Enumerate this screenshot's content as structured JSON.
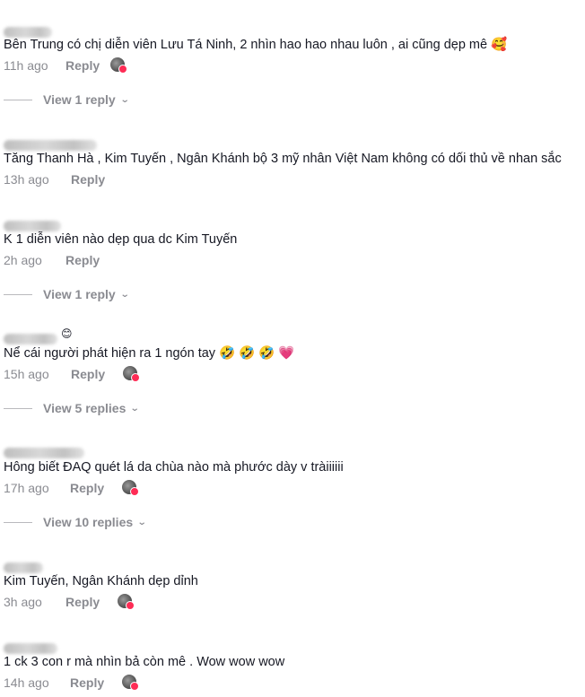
{
  "comments": [
    {
      "username": "",
      "text": "Bên Trung có chị diễn viên Lưu Tá Ninh, 2 nhìn hao hao nhau luôn , ai cũng dẹp mê 🥰",
      "time": "11h ago",
      "reply_label": "Reply",
      "creator_liked": true,
      "view_replies": "View 1 reply"
    },
    {
      "username": "",
      "text": "Tăng Thanh Hà , Kim Tuyến , Ngân Khánh bộ 3 mỹ nhân Việt Nam không có dối thủ về nhan sắc",
      "time": "13h ago",
      "reply_label": "Reply",
      "creator_liked": false,
      "view_replies": ""
    },
    {
      "username": "",
      "text": "K 1 diễn viên nào dẹp qua dc Kim Tuyến",
      "time": "2h ago",
      "reply_label": "Reply",
      "creator_liked": false,
      "view_replies": "View 1 reply"
    },
    {
      "username": "",
      "text": "Nể cái người phát hiện ra 1 ngón tay 🤣 🤣 🤣 💗",
      "time": "15h ago",
      "reply_label": "Reply",
      "creator_liked": true,
      "view_replies": "View 5 replies"
    },
    {
      "username": "",
      "text": "Hông biết ĐAQ quét lá da chùa nào mà phước dày v tràiiiiii",
      "time": "17h ago",
      "reply_label": "Reply",
      "creator_liked": true,
      "view_replies": "View 10 replies"
    },
    {
      "username": "",
      "text": "Kim Tuyến, Ngân Khánh dẹp dỉnh",
      "time": "3h ago",
      "reply_label": "Reply",
      "creator_liked": true,
      "view_replies": ""
    },
    {
      "username": "",
      "text": "1 ck 3 con r mà nhìn bả còn mê . Wow wow wow",
      "time": "14h ago",
      "reply_label": "Reply",
      "creator_liked": true,
      "view_replies": ""
    }
  ],
  "icons": {
    "creator_like": "creator-liked-avatar-icon",
    "chevron": "chevron-down-icon"
  },
  "colors": {
    "text": "#161823",
    "secondary": "#8a8b91",
    "heart": "#fe2c55"
  }
}
